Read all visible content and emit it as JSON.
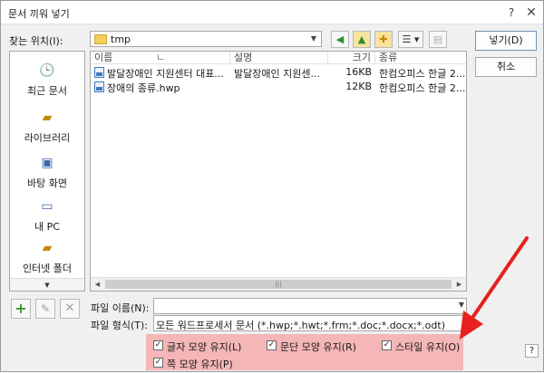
{
  "title": "문서 끼워 넣기",
  "titlebar": {
    "help": "?",
    "close": "✕"
  },
  "lookin": {
    "label": "찾는 위치(I):",
    "value": "tmp"
  },
  "places": [
    {
      "label": "최근 문서",
      "icon": "recent-docs-icon"
    },
    {
      "label": "라이브러리",
      "icon": "library-icon"
    },
    {
      "label": "바탕 화면",
      "icon": "desktop-icon"
    },
    {
      "label": "내 PC",
      "icon": "my-pc-icon"
    },
    {
      "label": "인터넷 폴더",
      "icon": "internet-folder-icon"
    }
  ],
  "columns": {
    "name": "이름",
    "sort": "ㄴ",
    "desc": "설명",
    "size": "크기",
    "kind": "종류"
  },
  "files": [
    {
      "name": "발달장애인 지원센터 대표...",
      "desc": "발달장애인 지원센...",
      "size": "16KB",
      "kind": "한컴오피스 한글 2..."
    },
    {
      "name": "장애의 종류.hwp",
      "desc": "",
      "size": "12KB",
      "kind": "한컴오피스 한글 2..."
    }
  ],
  "buttons": {
    "open": "넣기(D)",
    "cancel": "취소"
  },
  "filename": {
    "label": "파일 이름(N):",
    "value": ""
  },
  "filetype": {
    "label": "파일 형식(T):",
    "value": "모든 워드프로세서 문서 (*.hwp;*.hwt;*.frm;*.doc;*.docx;*.odt)"
  },
  "options": [
    {
      "label": "글자 모양 유지(L)",
      "checked": true
    },
    {
      "label": "문단 모양 유지(R)",
      "checked": true
    },
    {
      "label": "스타일 유지(O)",
      "checked": true
    },
    {
      "label": "쪽 모양 유지(P)",
      "checked": true
    }
  ],
  "colors": {
    "highlight": "#f4b6b6",
    "arrow": "#e8201e"
  }
}
